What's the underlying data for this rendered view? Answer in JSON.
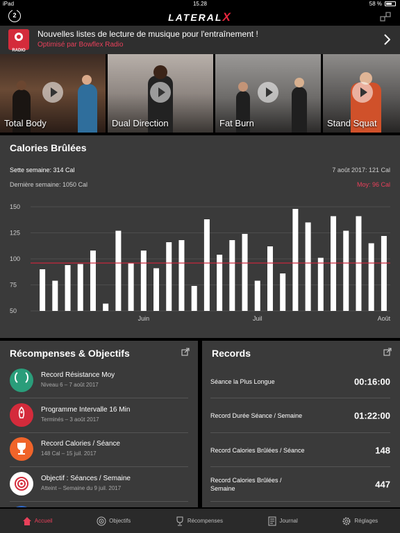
{
  "status": {
    "device": "iPad",
    "time": "15.28",
    "battery": "58 %"
  },
  "header": {
    "notification_count": "2",
    "logo": "LATERAL",
    "logo_mark": "X"
  },
  "banner": {
    "title": "Nouvelles listes de lecture de musique pour l'entraînement !",
    "subtitle": "Optimisé par Bowflex Radio",
    "logo_text": "RADIO"
  },
  "workouts": [
    {
      "label": "Total Body"
    },
    {
      "label": "Dual Direction"
    },
    {
      "label": "Fat Burn"
    },
    {
      "label": "Stand Squat"
    }
  ],
  "calories": {
    "title": "Calories Brûlées",
    "this_week": "Sette semaine: 314 Cal",
    "last_week": "Dernière semaine: 1050 Cal",
    "date_value": "7 août 2017:  121 Cal",
    "average": "Moy: 96 Cal"
  },
  "chart_data": {
    "type": "bar",
    "ylim": [
      50,
      150
    ],
    "yticks": [
      150,
      125,
      100,
      75,
      50
    ],
    "average_line": 96,
    "x_tick_labels": [
      {
        "label": "Juin",
        "index": 8
      },
      {
        "label": "Juil",
        "index": 17
      },
      {
        "label": "Août",
        "index": 27
      }
    ],
    "values": [
      90,
      79,
      94,
      95,
      108,
      57,
      127,
      96,
      108,
      91,
      116,
      118,
      74,
      138,
      104,
      118,
      124,
      79,
      112,
      86,
      148,
      135,
      101,
      141,
      127,
      141,
      115,
      122
    ],
    "colors": {
      "bar": "#ffffff",
      "average": "#c8283c",
      "grid": "#555555"
    }
  },
  "rewards": {
    "title": "Récompenses & Objectifs",
    "items": [
      {
        "title": "Record Résistance Moy",
        "sub": "Niveau 6 – 7 août 2017",
        "color": "#2a9d7a",
        "icon": "laurel-icon"
      },
      {
        "title": "Programme Intervalle 16 Min",
        "sub": "Terminés – 3 août 2017",
        "color": "#d42b3b",
        "icon": "rocket-icon"
      },
      {
        "title": "Record Calories / Séance",
        "sub": "148 Cal – 15 juil. 2017",
        "color": "#f0642a",
        "icon": "trophy-icon"
      },
      {
        "title": "Objectif : Séances / Semaine",
        "sub": "Atteint – Semaine du 9 juil. 2017",
        "color": "#ffffff",
        "icon": "target-icon"
      }
    ]
  },
  "records": {
    "title": "Records",
    "items": [
      {
        "title": "Séance la Plus Longue",
        "value": "00:16:00"
      },
      {
        "title": "Record Durée Séance / Semaine",
        "value": "01:22:00"
      },
      {
        "title": "Record Calories Brûlées / Séance",
        "value": "148"
      },
      {
        "title": "Record Calories Brûlées / Semaine",
        "value": "447"
      }
    ]
  },
  "tabs": [
    {
      "label": "Accueil",
      "icon": "home-icon",
      "active": true
    },
    {
      "label": "Objectifs",
      "icon": "target-icon",
      "active": false
    },
    {
      "label": "Récompenses",
      "icon": "trophy-icon",
      "active": false
    },
    {
      "label": "Journal",
      "icon": "journal-icon",
      "active": false
    },
    {
      "label": "Réglages",
      "icon": "gear-icon",
      "active": false
    }
  ]
}
